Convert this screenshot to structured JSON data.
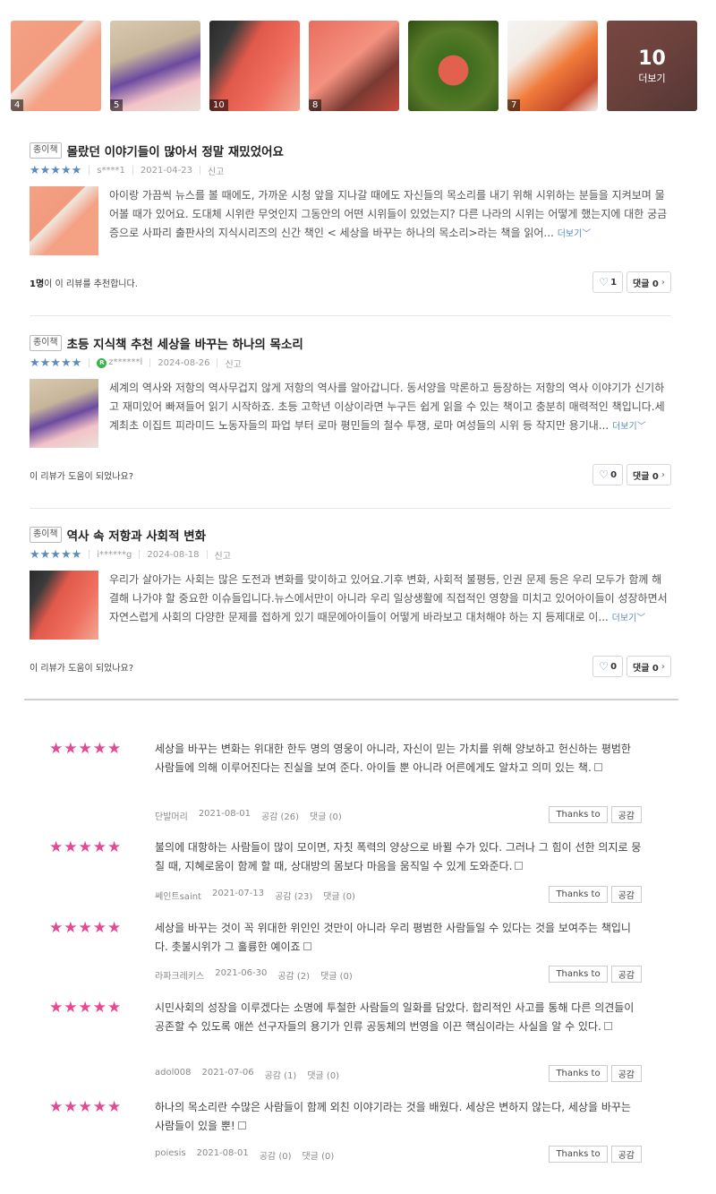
{
  "photos": [
    {
      "count": "4"
    },
    {
      "count": "5"
    },
    {
      "count": "10"
    },
    {
      "count": "8"
    },
    {
      "count": ""
    },
    {
      "count": "7"
    },
    {
      "count": "10",
      "more": "더보기"
    }
  ],
  "reviews": [
    {
      "badge": "종이책",
      "title": "몰랐던 이야기들이 많아서 정말 재밌었어요",
      "stars": "★★★★★",
      "user": "s****1",
      "date": "2021-04-23",
      "report": "신고",
      "text": "아이랑 가끔씩 뉴스를 볼 때에도, 가까운 시청 앞을 지나갈 때에도 자신들의 목소리를 내기 위해 시위하는 분들을 지켜보며 물어볼 때가 있어요. 도대체 시위란 무엇인지 그동안의 어떤 시위들이 있었는지? 다른 나라의 시위는 어떻게 했는지에 대한 궁금증으로 사파리 출판사의 지식시리즈의 신간 책인 < 세상을 바꾸는 하나의 목소리>라는 책을 읽어...",
      "more": "더보기",
      "helpful_count": "1명",
      "helpful": "이 이 리뷰를 추천합니다.",
      "likes": "1",
      "comments": "댓글 0"
    },
    {
      "badge": "종이책",
      "title": "초등 지식책 추천 세상을 바꾸는 하나의 목소리",
      "stars": "★★★★★",
      "user": "z******l",
      "date": "2024-08-26",
      "report": "신고",
      "text": "세계의 역사와 저항의 역사무겁지 않게 저항의 역사를 알아갑니다. 동서양을 막론하고 등장하는 저항의 역사 이야기가 신기하고 재미있어 빠져들어 읽기 시작하죠. 초등 고학년 이상이라면 누구든 쉽게 읽을 수 있는 책이고 충분히 매력적인 책입니다.세계최초 이집트 피라미드 노동자들의 파업 부터 로마 평민들의 철수 투쟁, 로마 여성들의 시위 등 작지만 용기내...",
      "more": "더보기",
      "helpful": "이 리뷰가 도움이 되었나요?",
      "likes": "0",
      "comments": "댓글 0"
    },
    {
      "badge": "종이책",
      "title": "역사 속 저항과 사회적 변화",
      "stars": "★★★★★",
      "user": "i******g",
      "date": "2024-08-18",
      "report": "신고",
      "text": "우리가 살아가는 사회는 많은 도전과 변화를 맞이하고 있어요.기후 변화, 사회적 불평등, 인권 문제 등은 우리 모두가 함께 해결해 나가야 할 중요한 이슈들입니다.뉴스에서만이 아니라 우리 일상생활에 직접적인 영향을 미치고 있어아이들이 성장하면서 자연스럽게 사회의 다양한 문제를 접하게 있기 때문에아이들이 어떻게 바라보고 대처해야 하는 지 등제대로 이...",
      "more": "더보기",
      "helpful": "이 리뷰가 도움이 되었나요?",
      "likes": "0",
      "comments": "댓글 0"
    }
  ],
  "short_reviews": [
    {
      "stars": "★★★★★",
      "text": "세상을 바꾸는 변화는 위대한 한두 명의 영웅이 아니라, 자신이 믿는 가치를 위해 양보하고 헌신하는 평범한 사람들에 의해 이루어진다는 진실을 보여 준다. 아이들 뿐 아니라 어른에게도 알차고 의미 있는 책.",
      "user": "단발머리",
      "date": "2021-08-01",
      "sympathy": "공감 (26)",
      "comments": "댓글 (0)",
      "thanks": "Thanks to",
      "like": "공감"
    },
    {
      "stars": "★★★★★",
      "text": "불의에 대항하는 사람들이 많이 모이면, 자칫 폭력의 양상으로 바뀔 수가 있다. 그러나 그 힘이 선한 의지로 뭉칠 때, 지혜로움이 함께 할 때, 상대방의 몸보다 마음을 움직일 수 있게 도와준다.",
      "user": "쎄인트saint",
      "date": "2021-07-13",
      "sympathy": "공감 (23)",
      "comments": "댓글 (0)",
      "thanks": "Thanks to",
      "like": "공감"
    },
    {
      "stars": "★★★★★",
      "text": "세상을 바꾸는 것이 꼭 위대한 위인인 것만이 아니라 우리 평범한 사람들일 수 있다는 것을 보여주는 책입니다. 촛불시위가 그 훌륭한 예이죠",
      "user": "라파크레키스",
      "date": "2021-06-30",
      "sympathy": "공감 (2)",
      "comments": "댓글 (0)",
      "thanks": "Thanks to",
      "like": "공감"
    },
    {
      "stars": "★★★★★",
      "text": "시민사회의 성장을 이루겠다는 소명에 투철한 사람들의 일화를 담았다. 합리적인 사고를 통해 다른 의견들이 공존할 수 있도록 애쓴 선구자들의 용기가 인류 공동체의 번영을 이끈 핵심이라는 사실을 알 수 있다.",
      "user": "adol008",
      "date": "2021-07-06",
      "sympathy": "공감 (1)",
      "comments": "댓글 (0)",
      "thanks": "Thanks to",
      "like": "공감"
    },
    {
      "stars": "★★★★★",
      "text": "하나의 목소리란 수많은 사람들이 함께 외친 이야기라는 것을 배웠다. 세상은 변하지 않는다, 세상을 바꾸는 사람들이 있을 뿐!",
      "user": "poiesis",
      "date": "2021-08-01",
      "sympathy": "공감 (0)",
      "comments": "댓글 (0)",
      "thanks": "Thanks to",
      "like": "공감"
    }
  ]
}
